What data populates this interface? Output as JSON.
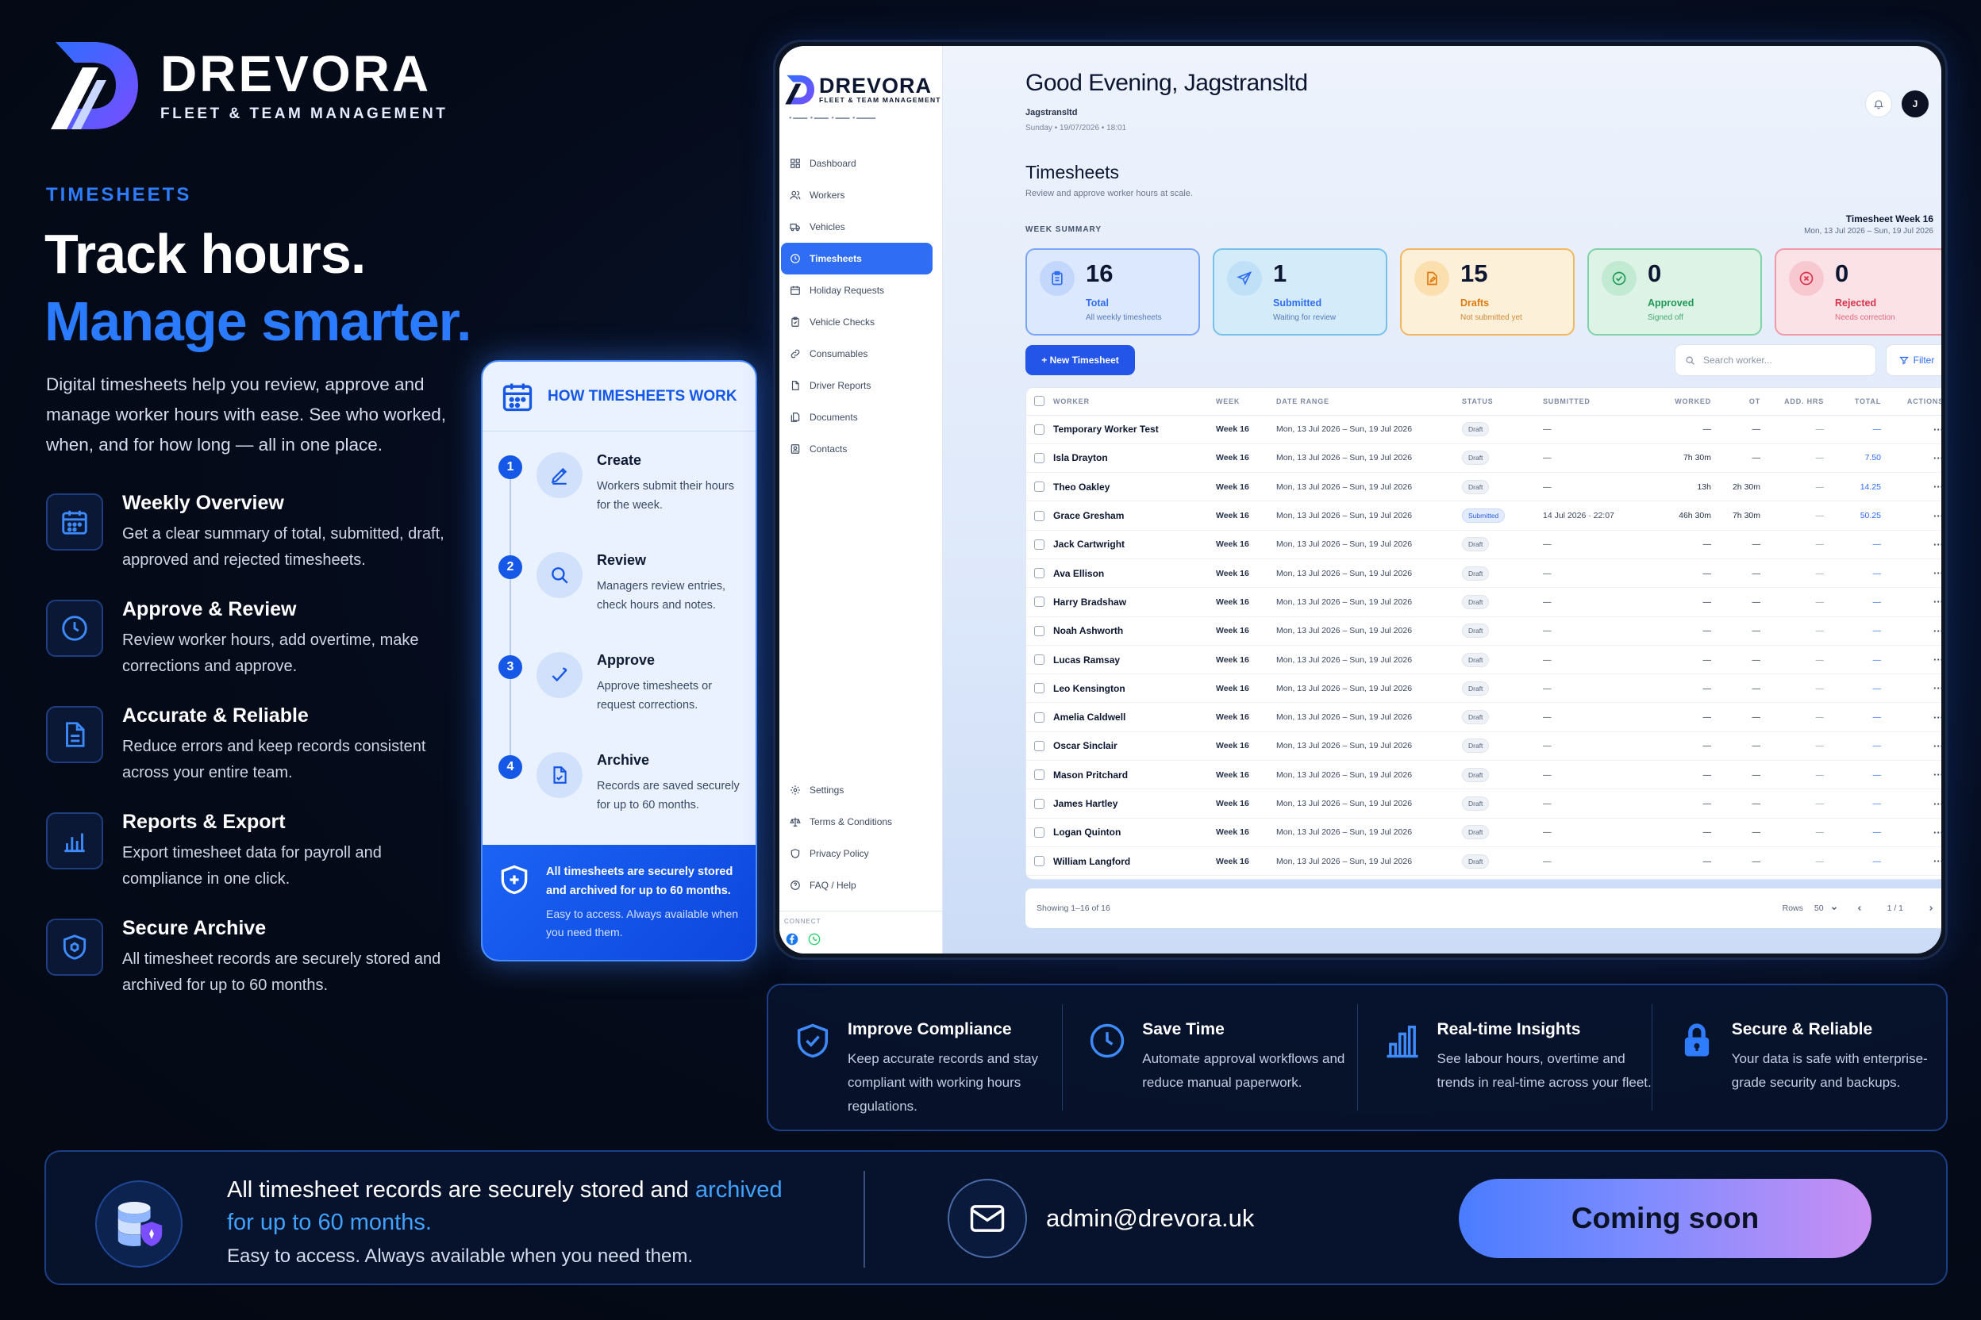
{
  "brand": {
    "name": "DREVORA",
    "tagline": "FLEET & TEAM MANAGEMENT"
  },
  "hero": {
    "eyebrow": "TIMESHEETS",
    "headline_1": "Track hours.",
    "headline_2": "Manage smarter.",
    "lede": "Digital timesheets help you review, approve and manage worker hours with ease. See who worked, when, and for how long — all in one place."
  },
  "features": [
    {
      "icon": "calendar-icon",
      "title": "Weekly Overview",
      "desc": "Get a clear summary of total, submitted, draft, approved and rejected timesheets."
    },
    {
      "icon": "clock-icon",
      "title": "Approve & Review",
      "desc": "Review worker hours, add overtime, make corrections and approve."
    },
    {
      "icon": "document-icon",
      "title": "Accurate & Reliable",
      "desc": "Reduce errors and keep records consistent across your entire team."
    },
    {
      "icon": "bar-chart-icon",
      "title": "Reports & Export",
      "desc": "Export timesheet data for payroll and compliance in one click."
    },
    {
      "icon": "shield-icon",
      "title": "Secure Archive",
      "desc": "All timesheet records are securely stored and archived for up to 60 months."
    }
  ],
  "how": {
    "title": "HOW TIMESHEETS WORK",
    "steps": [
      {
        "num": "1",
        "title": "Create",
        "desc": "Workers submit their hours for the week."
      },
      {
        "num": "2",
        "title": "Review",
        "desc": "Managers review entries, check hours and notes."
      },
      {
        "num": "3",
        "title": "Approve",
        "desc": "Approve timesheets or request corrections."
      },
      {
        "num": "4",
        "title": "Archive",
        "desc": "Records are saved securely for up to 60 months."
      }
    ],
    "footer_main": "All timesheets are securely stored and archived for up to 60 months.",
    "footer_sub": "Easy to access. Always available when you need them."
  },
  "app": {
    "sidebar": {
      "brand": "DREVORA",
      "brand_sub": "FLEET & TEAM MANAGEMENT",
      "nav": [
        "Dashboard",
        "Workers",
        "Vehicles",
        "Timesheets",
        "Holiday Requests",
        "Vehicle Checks",
        "Consumables",
        "Driver Reports",
        "Documents",
        "Contacts"
      ],
      "active_index": 3,
      "bottom": [
        "Settings",
        "Terms & Conditions",
        "Privacy Policy",
        "FAQ / Help"
      ],
      "connect_label": "CONNECT"
    },
    "greeting": "Good Evening, Jagstransltd",
    "account": "Jagstransltd",
    "datetime": "Sunday • 19/07/2026 • 18:01",
    "avatar_initial": "J",
    "section_title": "Timesheets",
    "section_sub": "Review and approve worker hours at scale.",
    "week_summary_label": "WEEK SUMMARY",
    "week_title": "Timesheet Week 16",
    "week_range": "Mon, 13 Jul 2026 – Sun, 19 Jul 2026",
    "cards": [
      {
        "count": "16",
        "label": "Total",
        "sub": "All weekly timesheets",
        "color": "#2f6df5",
        "bg": "#dbe8fd",
        "border": "#7aa6f5"
      },
      {
        "count": "1",
        "label": "Submitted",
        "sub": "Waiting for review",
        "color": "#2f6df5",
        "bg": "#d4ecfa",
        "border": "#76c1ea"
      },
      {
        "count": "15",
        "label": "Drafts",
        "sub": "Not submitted yet",
        "color": "#e07a10",
        "bg": "#fdf0d8",
        "border": "#f2b760"
      },
      {
        "count": "0",
        "label": "Approved",
        "sub": "Signed off",
        "color": "#1e9a55",
        "bg": "#dcf3e6",
        "border": "#7fd3a6"
      },
      {
        "count": "0",
        "label": "Rejected",
        "sub": "Needs correction",
        "color": "#d8334a",
        "bg": "#fbe2e6",
        "border": "#f09aa8"
      }
    ],
    "new_button": "+ New Timesheet",
    "search_placeholder": "Search worker...",
    "filter_label": "Filter",
    "columns": [
      "WORKER",
      "WEEK",
      "DATE RANGE",
      "STATUS",
      "SUBMITTED",
      "WORKED",
      "OT",
      "ADD. HRS",
      "TOTAL",
      "ACTIONS"
    ],
    "rows": [
      {
        "worker": "Temporary Worker Test",
        "week": "Week 16",
        "range": "Mon, 13 Jul 2026 – Sun, 19 Jul 2026",
        "status": "Draft",
        "submitted": "—",
        "worked": "—",
        "ot": "—",
        "add": "—",
        "total": "—"
      },
      {
        "worker": "Isla Drayton",
        "week": "Week 16",
        "range": "Mon, 13 Jul 2026 – Sun, 19 Jul 2026",
        "status": "Draft",
        "submitted": "—",
        "worked": "7h 30m",
        "ot": "—",
        "add": "—",
        "total": "7.50"
      },
      {
        "worker": "Theo Oakley",
        "week": "Week 16",
        "range": "Mon, 13 Jul 2026 – Sun, 19 Jul 2026",
        "status": "Draft",
        "submitted": "—",
        "worked": "13h",
        "ot": "2h 30m",
        "add": "—",
        "total": "14.25"
      },
      {
        "worker": "Grace Gresham",
        "week": "Week 16",
        "range": "Mon, 13 Jul 2026 – Sun, 19 Jul 2026",
        "status": "Submitted",
        "submitted": "14 Jul 2026 · 22:07",
        "worked": "46h 30m",
        "ot": "7h 30m",
        "add": "—",
        "total": "50.25"
      },
      {
        "worker": "Jack Cartwright",
        "week": "Week 16",
        "range": "Mon, 13 Jul 2026 – Sun, 19 Jul 2026",
        "status": "Draft",
        "submitted": "—",
        "worked": "—",
        "ot": "—",
        "add": "—",
        "total": "—"
      },
      {
        "worker": "Ava Ellison",
        "week": "Week 16",
        "range": "Mon, 13 Jul 2026 – Sun, 19 Jul 2026",
        "status": "Draft",
        "submitted": "—",
        "worked": "—",
        "ot": "—",
        "add": "—",
        "total": "—"
      },
      {
        "worker": "Harry Bradshaw",
        "week": "Week 16",
        "range": "Mon, 13 Jul 2026 – Sun, 19 Jul 2026",
        "status": "Draft",
        "submitted": "—",
        "worked": "—",
        "ot": "—",
        "add": "—",
        "total": "—"
      },
      {
        "worker": "Noah Ashworth",
        "week": "Week 16",
        "range": "Mon, 13 Jul 2026 – Sun, 19 Jul 2026",
        "status": "Draft",
        "submitted": "—",
        "worked": "—",
        "ot": "—",
        "add": "—",
        "total": "—"
      },
      {
        "worker": "Lucas Ramsay",
        "week": "Week 16",
        "range": "Mon, 13 Jul 2026 – Sun, 19 Jul 2026",
        "status": "Draft",
        "submitted": "—",
        "worked": "—",
        "ot": "—",
        "add": "—",
        "total": "—"
      },
      {
        "worker": "Leo Kensington",
        "week": "Week 16",
        "range": "Mon, 13 Jul 2026 – Sun, 19 Jul 2026",
        "status": "Draft",
        "submitted": "—",
        "worked": "—",
        "ot": "—",
        "add": "—",
        "total": "—"
      },
      {
        "worker": "Amelia Caldwell",
        "week": "Week 16",
        "range": "Mon, 13 Jul 2026 – Sun, 19 Jul 2026",
        "status": "Draft",
        "submitted": "—",
        "worked": "—",
        "ot": "—",
        "add": "—",
        "total": "—"
      },
      {
        "worker": "Oscar Sinclair",
        "week": "Week 16",
        "range": "Mon, 13 Jul 2026 – Sun, 19 Jul 2026",
        "status": "Draft",
        "submitted": "—",
        "worked": "—",
        "ot": "—",
        "add": "—",
        "total": "—"
      },
      {
        "worker": "Mason Pritchard",
        "week": "Week 16",
        "range": "Mon, 13 Jul 2026 – Sun, 19 Jul 2026",
        "status": "Draft",
        "submitted": "—",
        "worked": "—",
        "ot": "—",
        "add": "—",
        "total": "—"
      },
      {
        "worker": "James Hartley",
        "week": "Week 16",
        "range": "Mon, 13 Jul 2026 – Sun, 19 Jul 2026",
        "status": "Draft",
        "submitted": "—",
        "worked": "—",
        "ot": "—",
        "add": "—",
        "total": "—"
      },
      {
        "worker": "Logan Quinton",
        "week": "Week 16",
        "range": "Mon, 13 Jul 2026 – Sun, 19 Jul 2026",
        "status": "Draft",
        "submitted": "—",
        "worked": "—",
        "ot": "—",
        "add": "—",
        "total": "—"
      },
      {
        "worker": "William Langford",
        "week": "Week 16",
        "range": "Mon, 13 Jul 2026 – Sun, 19 Jul 2026",
        "status": "Draft",
        "submitted": "—",
        "worked": "—",
        "ot": "—",
        "add": "—",
        "total": "—"
      }
    ],
    "row_actions": "···",
    "pager": {
      "showing": "Showing 1–16 of 16",
      "rows_label": "Rows",
      "rows_value": "50",
      "page": "1 / 1"
    }
  },
  "benefits": [
    {
      "icon": "shield-check-icon",
      "title": "Improve Compliance",
      "desc": "Keep accurate records and stay compliant with working hours regulations."
    },
    {
      "icon": "clock-icon",
      "title": "Save Time",
      "desc": "Automate approval workflows and reduce manual paperwork."
    },
    {
      "icon": "bar-chart-icon",
      "title": "Real-time Insights",
      "desc": "See labour hours, overtime and trends in real-time across your fleet."
    },
    {
      "icon": "padlock-icon",
      "title": "Secure & Reliable",
      "desc": "Your data is safe with enterprise-grade security and backups."
    }
  ],
  "footer": {
    "line1_a": "All timesheet records are securely stored and ",
    "line1_hl": "archived for up to 60 months.",
    "line2": "Easy to access. Always available when you need them.",
    "email": "admin@drevora.uk",
    "cta": "Coming soon"
  }
}
